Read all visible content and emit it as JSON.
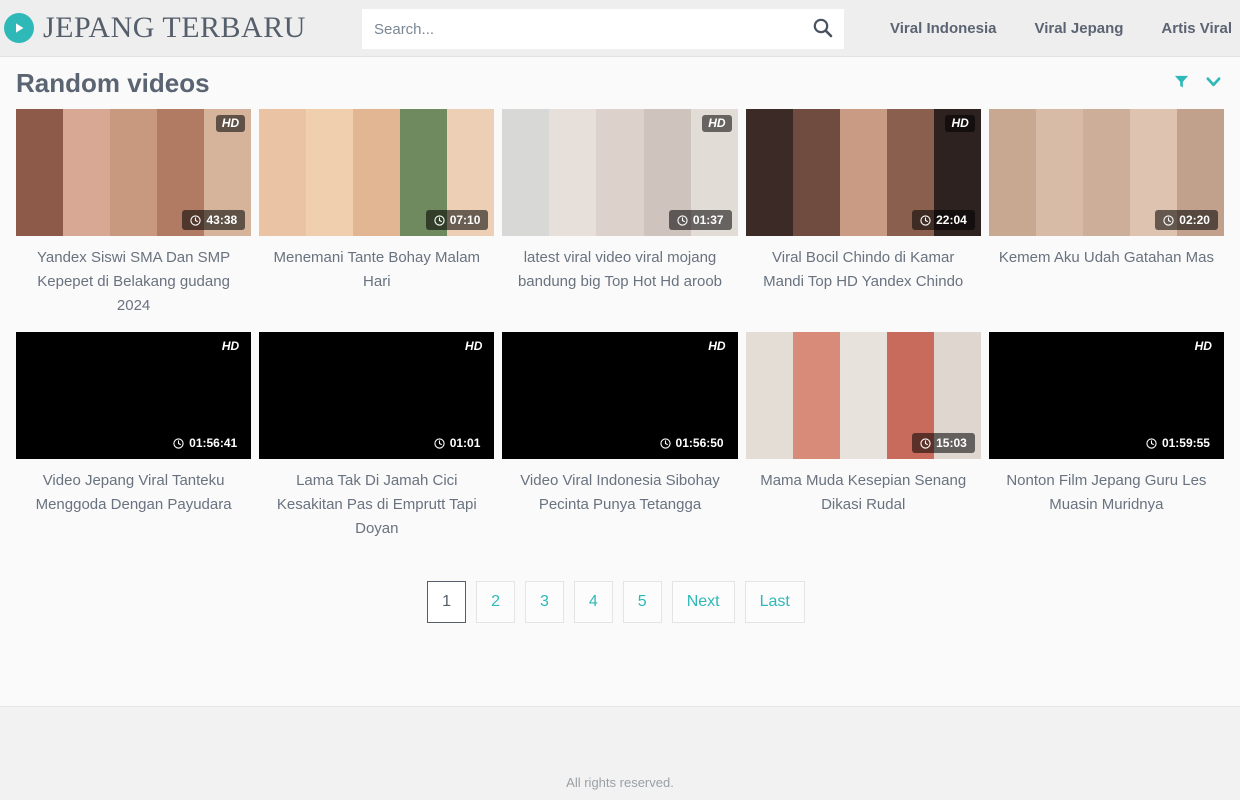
{
  "header": {
    "logo_icon": "play-circle-icon",
    "logo_text": "JEPANG TERBARU",
    "accent_color": "#2eb8b8",
    "search": {
      "placeholder": "Search...",
      "value": "",
      "button_icon": "search-icon"
    },
    "nav": [
      {
        "label": "Viral Indonesia"
      },
      {
        "label": "Viral Jepang"
      },
      {
        "label": "Artis Viral"
      }
    ]
  },
  "section": {
    "title": "Random videos",
    "filter_icon": "filter-icon",
    "sort_icon": "chevron-down-icon"
  },
  "videos": [
    {
      "title": "Yandex Siswi SMA Dan SMP Kepepet di Belakang gudang 2024",
      "hd": "HD",
      "duration": "43:38",
      "thumb_loaded": true,
      "colors": [
        "#8d5a4a",
        "#d9a894",
        "#c8987f",
        "#b07a63",
        "#d6b39b"
      ]
    },
    {
      "title": "Menemani Tante Bohay Malam Hari",
      "hd": "",
      "duration": "07:10",
      "thumb_loaded": true,
      "colors": [
        "#e9c3a3",
        "#f0cfae",
        "#e3b693",
        "#6f8a5e",
        "#eccfb4"
      ]
    },
    {
      "title": "latest viral video viral mojang bandung big Top Hot Hd aroob",
      "hd": "HD",
      "duration": "01:37",
      "thumb_loaded": true,
      "colors": [
        "#d8d8d6",
        "#e7e0da",
        "#dcd2cb",
        "#cfc4bd",
        "#e2dcd6"
      ]
    },
    {
      "title": "Viral Bocil Chindo di Kamar Mandi Top HD Yandex Chindo",
      "hd": "HD",
      "duration": "22:04",
      "thumb_loaded": true,
      "colors": [
        "#3b2a26",
        "#6f4b40",
        "#c99b84",
        "#8a5f4e",
        "#2e2220"
      ]
    },
    {
      "title": "Kemem Aku Udah Gatahan Mas",
      "hd": "",
      "duration": "02:20",
      "thumb_loaded": true,
      "colors": [
        "#c9a892",
        "#d8bba6",
        "#cdae99",
        "#ddc3b0",
        "#c2a18c"
      ]
    },
    {
      "title": "Video Jepang Viral Tanteku Menggoda Dengan Payudara",
      "hd": "HD",
      "duration": "01:56:41",
      "thumb_loaded": false,
      "colors": [
        "#000000"
      ]
    },
    {
      "title": "Lama Tak Di Jamah Cici Kesakitan Pas di Emprutt Tapi Doyan",
      "hd": "HD",
      "duration": "01:01",
      "thumb_loaded": false,
      "colors": [
        "#000000"
      ]
    },
    {
      "title": "Video Viral Indonesia Sibohay Pecinta Punya Tetangga",
      "hd": "HD",
      "duration": "01:56:50",
      "thumb_loaded": false,
      "colors": [
        "#000000"
      ]
    },
    {
      "title": "Mama Muda Kesepian Senang Dikasi Rudal",
      "hd": "",
      "duration": "15:03",
      "thumb_loaded": true,
      "colors": [
        "#e4ddd6",
        "#d98b7a",
        "#e8e2dc",
        "#c96b5c",
        "#ded6cf"
      ]
    },
    {
      "title": "Nonton Film Jepang Guru Les Muasin Muridnya",
      "hd": "HD",
      "duration": "01:59:55",
      "thumb_loaded": false,
      "colors": [
        "#000000"
      ]
    }
  ],
  "pagination": [
    {
      "label": "1",
      "active": true
    },
    {
      "label": "2",
      "active": false
    },
    {
      "label": "3",
      "active": false
    },
    {
      "label": "4",
      "active": false
    },
    {
      "label": "5",
      "active": false
    },
    {
      "label": "Next",
      "active": false
    },
    {
      "label": "Last",
      "active": false
    }
  ],
  "footer": {
    "text": "All rights reserved."
  }
}
